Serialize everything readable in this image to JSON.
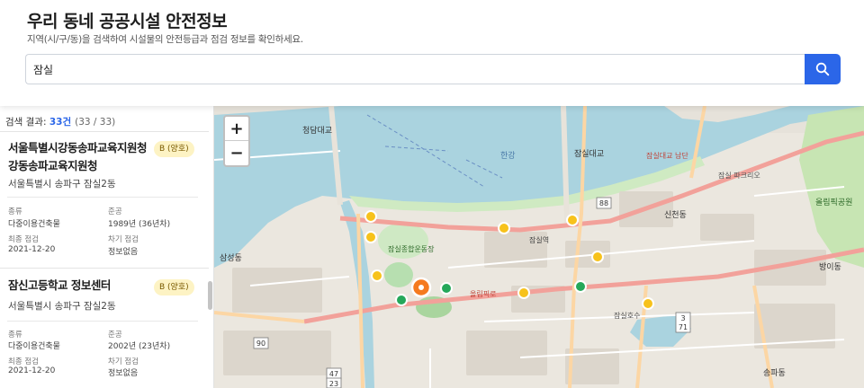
{
  "header": {
    "title": "우리 동네 공공시설 안전정보",
    "subtitle": "지역(시/구/동)을 검색하여 시설물의 안전등급과 점검 정보를 확인하세요."
  },
  "search": {
    "value": "잠실"
  },
  "results": {
    "label": "검색 결과: ",
    "count": "33건",
    "paging": "(33 / 33)"
  },
  "cards": [
    {
      "name": "서울특별시강동송파교육지원청 강동송파교육지원청",
      "badge": "B (양호)",
      "address": "서울특별시 송파구 잠실2동",
      "type_label": "종류",
      "type_value": "다중이용건축물",
      "built_label": "준공",
      "built_value": "1989년 (36년차)",
      "last_label": "최종 점검",
      "last_value": "2021-12-20",
      "next_label": "차기 점검",
      "next_value": "정보없음"
    },
    {
      "name": "잠신고등학교 정보센터",
      "badge": "B (양호)",
      "address": "서울특별시 송파구 잠실2동",
      "type_label": "종류",
      "type_value": "다중이용건축물",
      "built_label": "준공",
      "built_value": "2002년 (23년차)",
      "last_label": "최종 점검",
      "last_value": "2021-12-20",
      "next_label": "차기 점검",
      "next_value": "정보없음"
    }
  ],
  "map": {
    "zoom_in": "+",
    "zoom_out": "−",
    "labels": {
      "bridge": "잠실대교",
      "bridge_s": "잠실대교 남단",
      "cheongdam": "청담대교",
      "han": "한강",
      "sports": "잠실종합운동장",
      "sinchon": "신천동",
      "olympic": "올림픽로",
      "olympic_park": "올림픽공원",
      "jamsil_park": "잠실 파크리오",
      "samseong": "삼성동",
      "bangi": "방이동",
      "songpa": "송파동",
      "jamsil_station": "잠실역",
      "jamsil_lake": "잠실호수",
      "road88": "88",
      "road90": "90",
      "road47": "47",
      "road23": "23",
      "road71": "71",
      "road3": "3"
    }
  },
  "colors": {
    "accent": "#2b66e8",
    "marker_yellow": "#f7c21b",
    "marker_green": "#25a85a",
    "marker_orange": "#f57a1f",
    "water": "#aad3df"
  }
}
